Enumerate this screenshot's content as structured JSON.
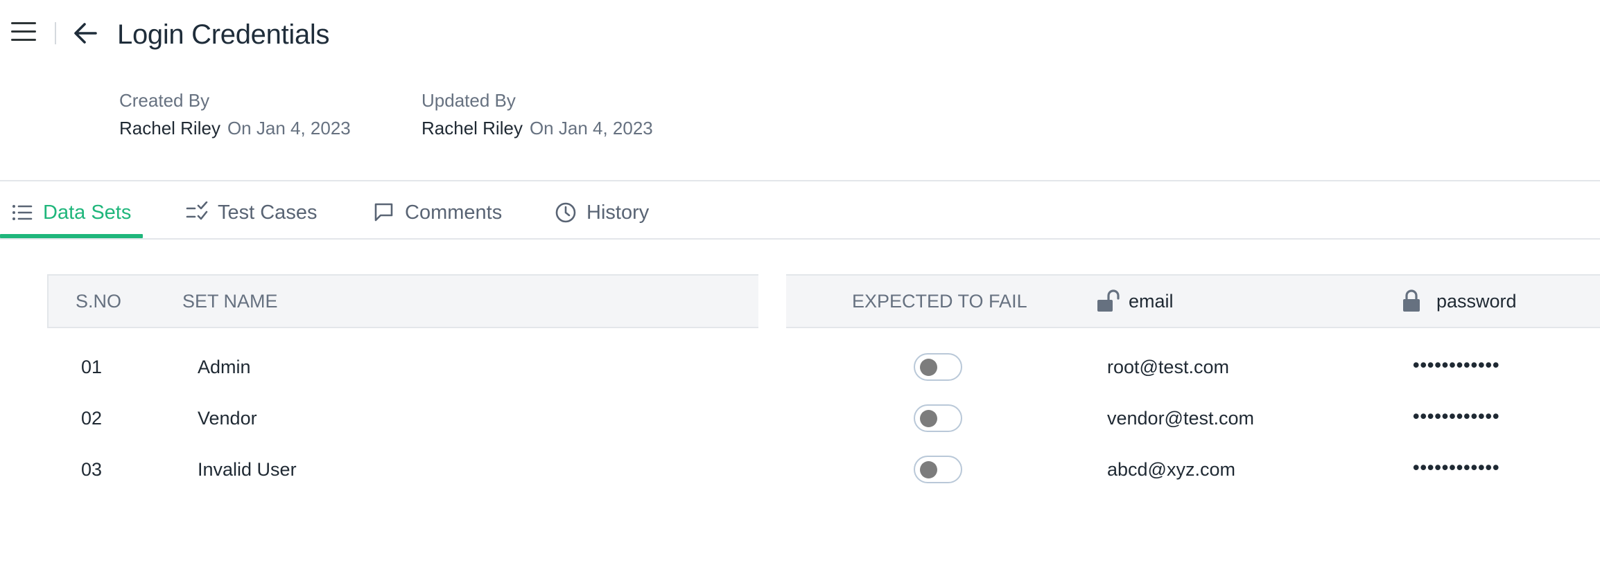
{
  "header": {
    "title": "Login Credentials"
  },
  "meta": {
    "created": {
      "label": "Created By",
      "name": "Rachel Riley",
      "date": "On Jan 4, 2023"
    },
    "updated": {
      "label": "Updated By",
      "name": "Rachel Riley",
      "date": "On Jan 4, 2023"
    }
  },
  "tabs": [
    {
      "label": "Data Sets",
      "icon": "list-icon",
      "active": true
    },
    {
      "label": "Test Cases",
      "icon": "checklist-icon",
      "active": false
    },
    {
      "label": "Comments",
      "icon": "comment-icon",
      "active": false
    },
    {
      "label": "History",
      "icon": "clock-icon",
      "active": false
    }
  ],
  "table": {
    "headers": {
      "sno": "S.NO",
      "set_name": "SET NAME",
      "expected_to_fail": "EXPECTED TO FAIL",
      "email": "email",
      "password": "password"
    },
    "rows": [
      {
        "sno": "01",
        "name": "Admin",
        "expected_to_fail": false,
        "email": "root@test.com",
        "password": "••••••••••••"
      },
      {
        "sno": "02",
        "name": "Vendor",
        "expected_to_fail": false,
        "email": "vendor@test.com",
        "password": "••••••••••••"
      },
      {
        "sno": "03",
        "name": "Invalid User",
        "expected_to_fail": false,
        "email": "abcd@xyz.com",
        "password": "••••••••••••"
      }
    ]
  },
  "colors": {
    "accent": "#1fb67b",
    "text": "#1f2933",
    "muted": "#667180",
    "header_bg": "#f4f5f7"
  }
}
